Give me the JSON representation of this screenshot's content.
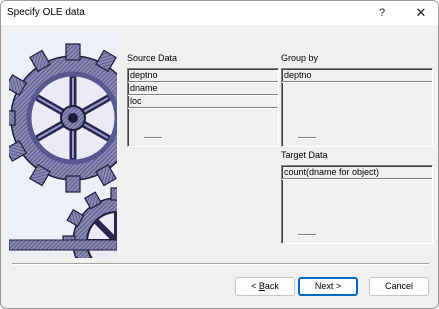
{
  "window": {
    "title": "Specify OLE data",
    "help_glyph": "?",
    "close_glyph": "✕"
  },
  "source": {
    "label": "Source Data",
    "items": [
      "deptno",
      "dname",
      "loc"
    ]
  },
  "group": {
    "label": "Group by",
    "items": [
      "deptno"
    ]
  },
  "target": {
    "label": "Target Data",
    "items": [
      "count(dname for object)"
    ]
  },
  "buttons": {
    "back": "< Back",
    "back_prefix": "< ",
    "back_mnemonic": "B",
    "back_rest": "ack",
    "next": "Next >",
    "cancel": "Cancel"
  },
  "icons": {
    "help": "question-mark-icon",
    "close": "close-icon",
    "art": "gears-illustration"
  }
}
